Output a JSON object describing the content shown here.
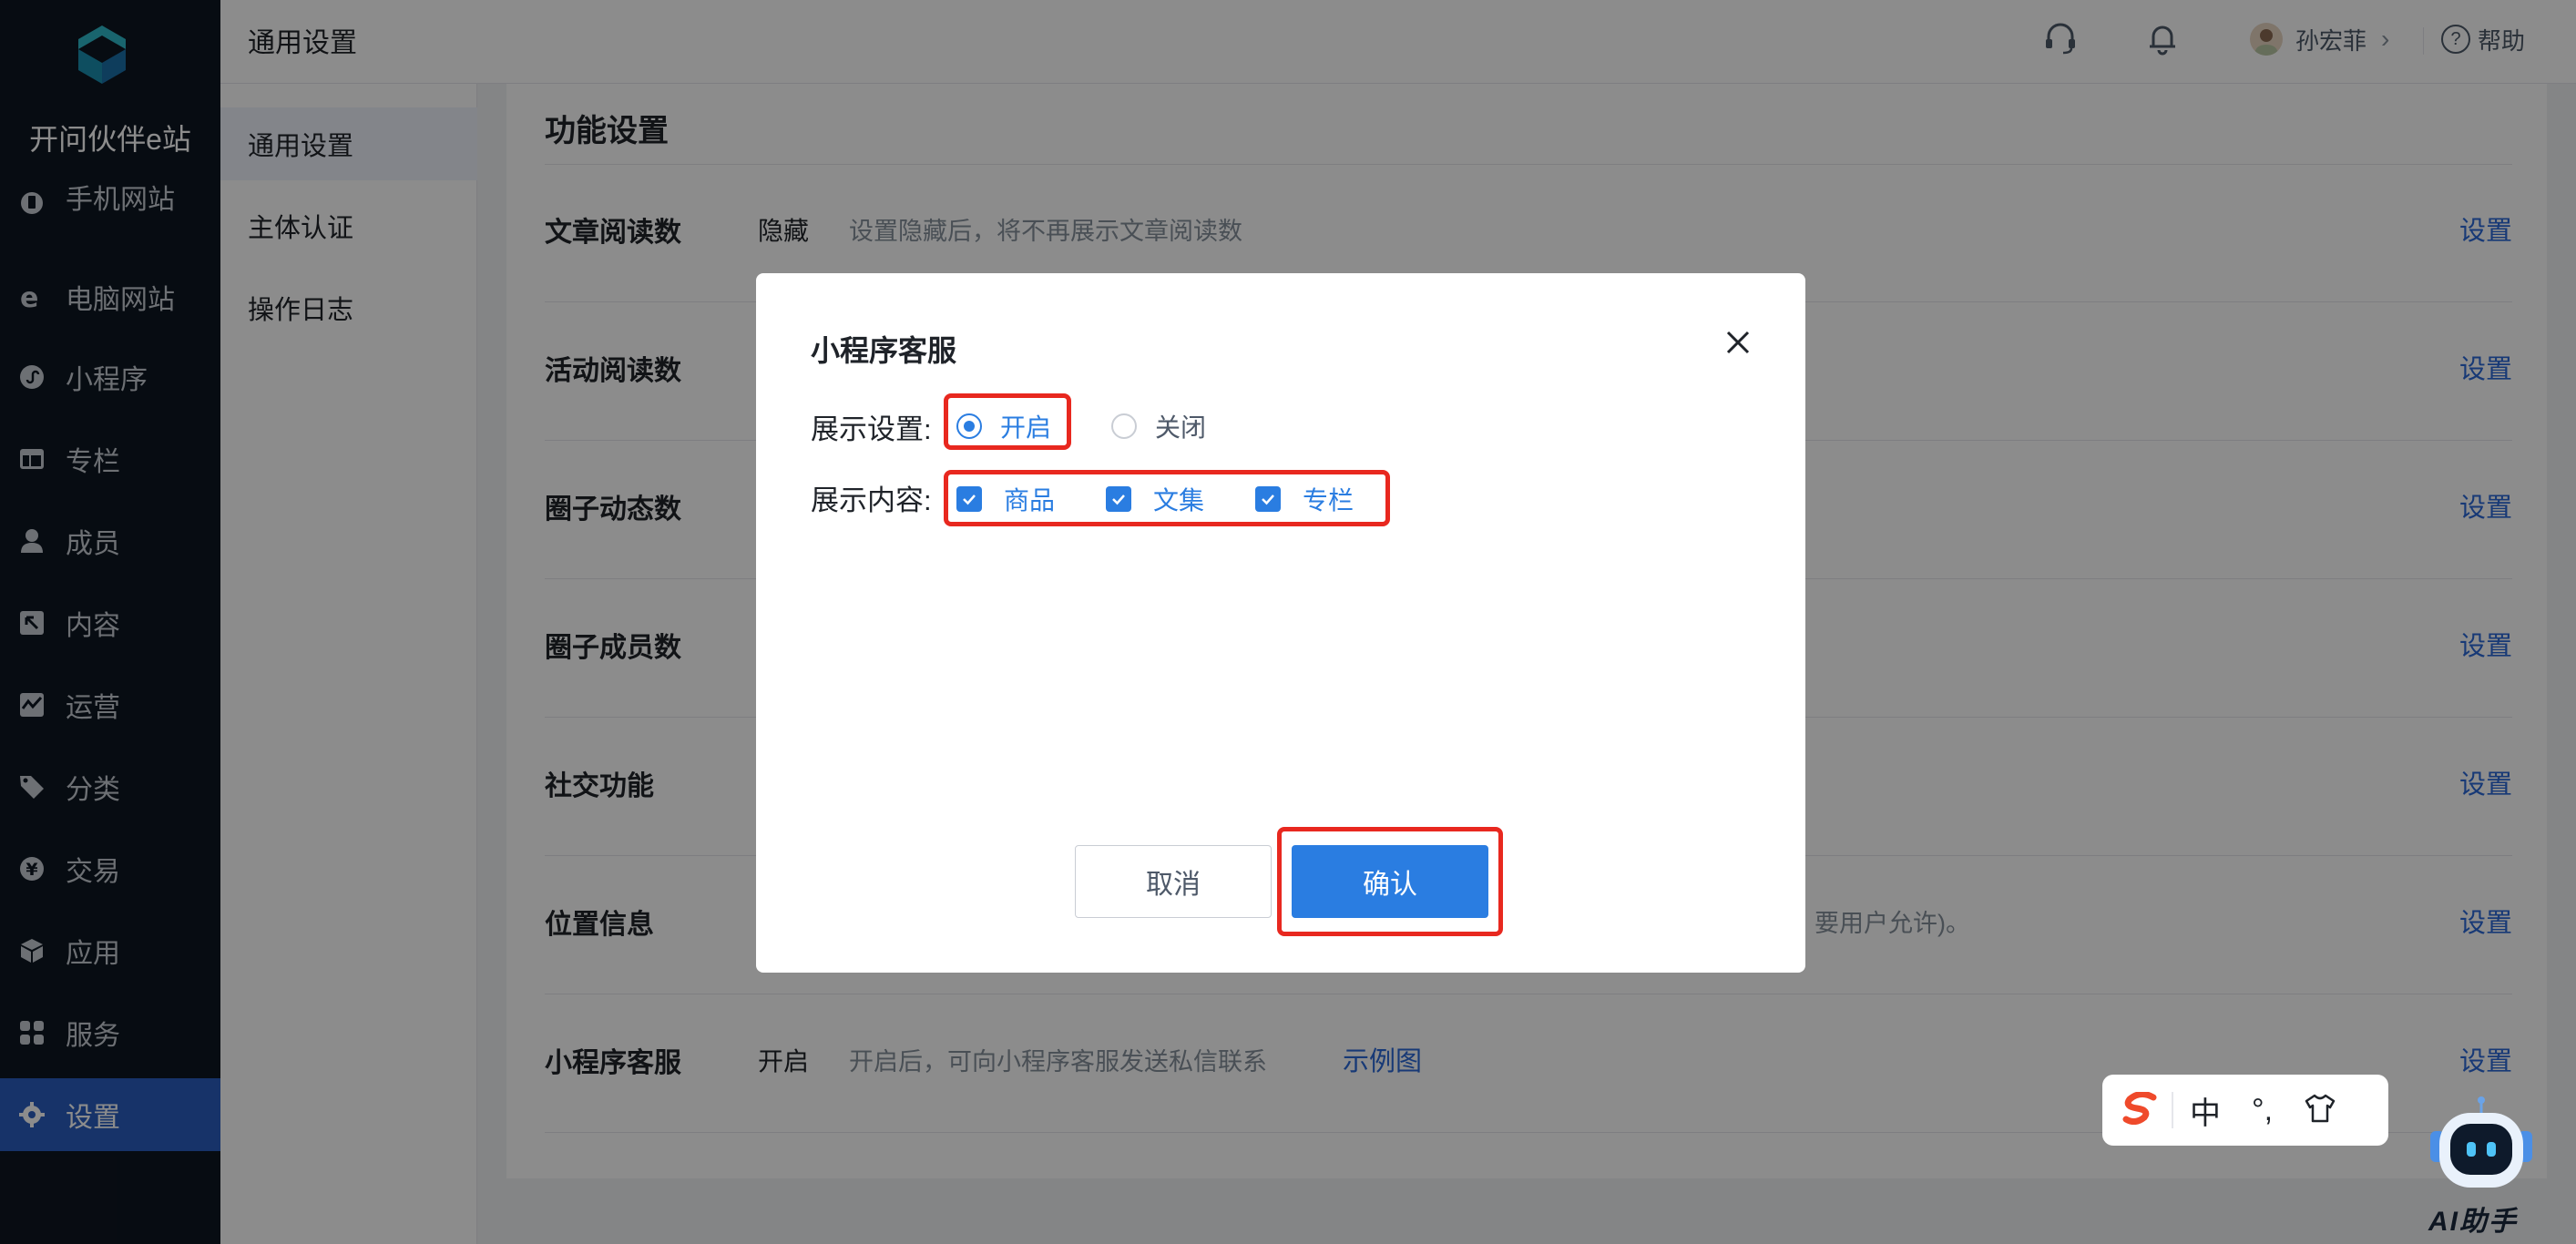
{
  "sidebar": {
    "brand": "开问伙伴e站",
    "items": [
      {
        "label": "手机网站",
        "icon": "mobile-icon"
      },
      {
        "label": "电脑网站",
        "icon": "browser-icon"
      },
      {
        "label": "小程序",
        "icon": "miniprogram-icon"
      },
      {
        "label": "专栏",
        "icon": "column-icon"
      },
      {
        "label": "成员",
        "icon": "user-icon"
      },
      {
        "label": "内容",
        "icon": "content-icon"
      },
      {
        "label": "运营",
        "icon": "operations-icon"
      },
      {
        "label": "分类",
        "icon": "tag-icon"
      },
      {
        "label": "交易",
        "icon": "yen-icon"
      },
      {
        "label": "应用",
        "icon": "cube-icon"
      },
      {
        "label": "服务",
        "icon": "grid-icon"
      },
      {
        "label": "设置",
        "icon": "gear-icon",
        "active": true
      }
    ]
  },
  "header": {
    "title": "通用设置",
    "user_name": "孙宏菲",
    "help_label": "帮助"
  },
  "submenu": {
    "items": [
      {
        "label": "通用设置",
        "active": true
      },
      {
        "label": "主体认证"
      },
      {
        "label": "操作日志"
      }
    ]
  },
  "main": {
    "section_title": "功能设置",
    "rows": [
      {
        "label": "文章阅读数",
        "value": "隐藏",
        "desc": "设置隐藏后，将不再展示文章阅读数",
        "action": "设置"
      },
      {
        "label": "活动阅读数",
        "action": "设置"
      },
      {
        "label": "圈子动态数",
        "action": "设置"
      },
      {
        "label": "圈子成员数",
        "action": "设置"
      },
      {
        "label": "社交功能",
        "action": "设置"
      },
      {
        "label": "位置信息",
        "desc_tail": "要用户允许)。",
        "action": "设置"
      },
      {
        "label": "小程序客服",
        "value": "开启",
        "desc": "开启后，可向小程序客服发送私信联系",
        "link": "示例图",
        "action": "设置"
      }
    ]
  },
  "modal": {
    "title": "小程序客服",
    "display_setting_label": "展示设置:",
    "display_options": [
      {
        "label": "开启",
        "checked": true
      },
      {
        "label": "关闭",
        "checked": false
      }
    ],
    "display_content_label": "展示内容:",
    "content_options": [
      {
        "label": "商品",
        "checked": true
      },
      {
        "label": "文集",
        "checked": true
      },
      {
        "label": "专栏",
        "checked": true
      }
    ],
    "cancel_label": "取消",
    "confirm_label": "确认"
  },
  "ime": {
    "mode": "中",
    "punct": "°,"
  },
  "ai_assistant": {
    "label": "AI助手"
  },
  "colors": {
    "sidebar_bg": "#0e1621",
    "accent": "#2a7de1",
    "highlight": "#e8281f",
    "link": "#2a68d8"
  }
}
